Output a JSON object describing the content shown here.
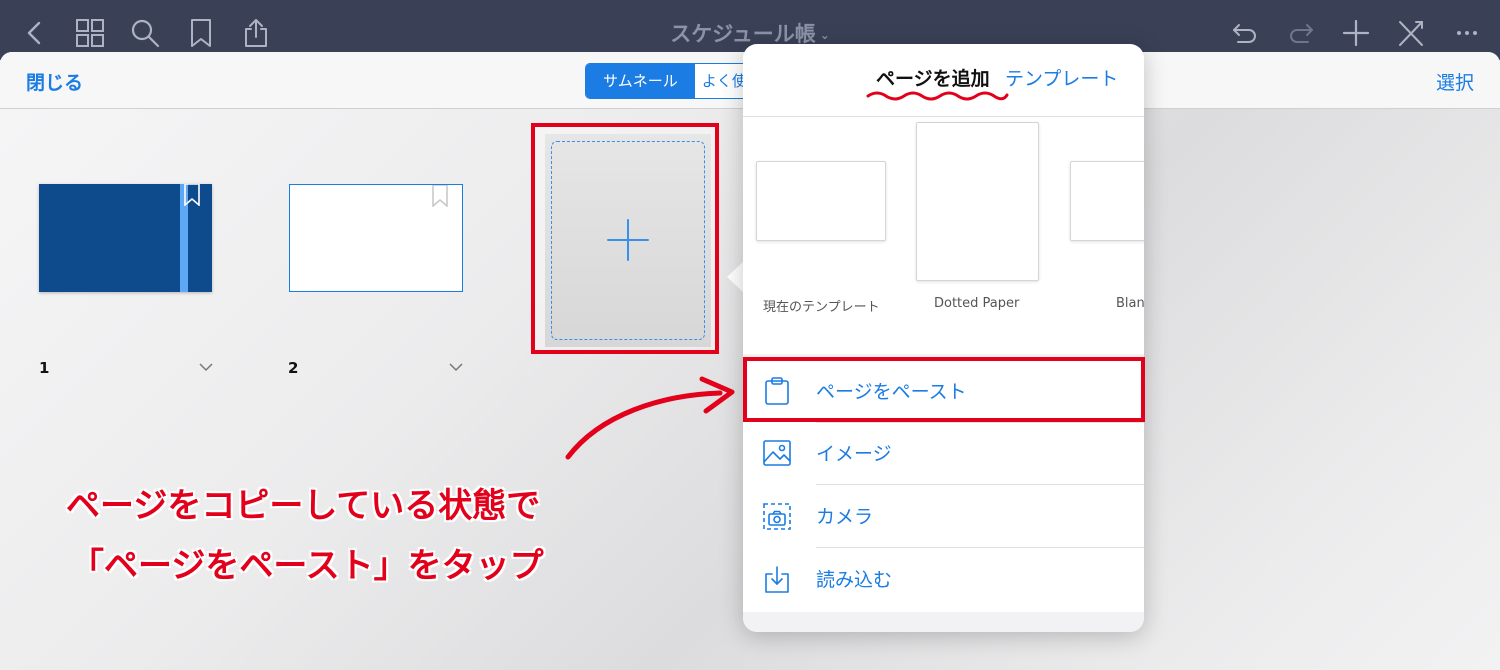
{
  "topbar": {
    "title": "スケジュール帳",
    "icons": [
      "back-icon",
      "grid-icon",
      "search-icon",
      "bookmark-icon",
      "share-icon",
      "undo-icon",
      "redo-icon",
      "plus-icon",
      "tools-icon",
      "more-icon"
    ]
  },
  "sheet": {
    "close_label": "閉じる",
    "select_label": "選択",
    "segments": [
      "サムネール",
      "よく使"
    ],
    "pages": [
      {
        "number": "1"
      },
      {
        "number": "2"
      }
    ]
  },
  "popover": {
    "tabs": [
      "ページを追加",
      "テンプレート"
    ],
    "templates": [
      "現在のテンプレート",
      "Dotted Paper",
      "Blan"
    ],
    "menu": [
      {
        "label": "ページをペースト",
        "icon": "clipboard-icon"
      },
      {
        "label": "イメージ",
        "icon": "image-icon"
      },
      {
        "label": "カメラ",
        "icon": "camera-icon"
      },
      {
        "label": "読み込む",
        "icon": "import-icon"
      }
    ]
  },
  "annotation": {
    "line1": "ページをコピーしている状態で",
    "line2": "「ページをペースト」をタップ"
  },
  "colors": {
    "topbar": "#3a4157",
    "accent": "#1b7ce3",
    "annotation": "#e3001b",
    "cover": "#0e4b8c"
  }
}
